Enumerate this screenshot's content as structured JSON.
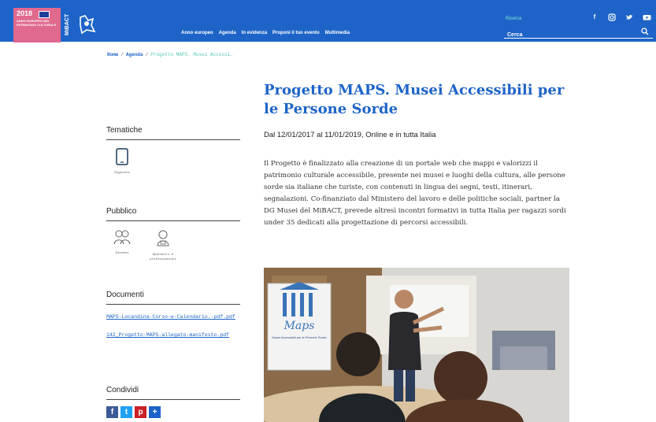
{
  "header": {
    "logo_year": "2018",
    "logo_text": "ANNO EUROPEO DEL PATRIMONIO CULTURALE",
    "ministry": "MiBACT",
    "nav": [
      "Anno europeo",
      "Agenda",
      "In evidenza",
      "Proponi il tuo evento",
      "Multimedia"
    ],
    "search_label": "Ricerca",
    "search_placeholder": "Cerca",
    "social": [
      "f",
      "ig",
      "tw",
      "yt"
    ],
    "brand_color": "#1e64c8",
    "logo_color": "#e0698e"
  },
  "breadcrumb": {
    "home": "Home",
    "agenda": "Agenda",
    "current": "Progetto MAPS. Musei Accessi…"
  },
  "article": {
    "title": "Progetto MAPS. Musei Accessibili per le Persone Sorde",
    "dates": "Dal 12/01/2017 al 11/01/2019, Online e in tutta Italia",
    "description": "Il Progetto è finalizzato alla creazione di un portale web che mappi e valorizzi il patrimonio culturale accessibile, presente nei musei e luoghi della cultura, alle persone sorde sia italiane che turiste, con contenuti in lingua dei segni, testi, itinerari, segnalazioni. Co-finanziato dal Ministero del lavoro e delle politiche sociali, partner la DG Musei del MiBACT, prevede altresì incontri formativi in tutta Italia per ragazzi sordi under 35 dedicati alla progettazione di percorsi accessibili."
  },
  "sidebar": {
    "tematiche": {
      "title": "Tematiche",
      "items": [
        {
          "label": "Digitale",
          "icon": "tablet-icon"
        }
      ]
    },
    "pubblico": {
      "title": "Pubblico",
      "items": [
        {
          "label": "Giovani",
          "icon": "young-people-icon"
        },
        {
          "label": "Operatori e professionisti",
          "icon": "operator-icon"
        }
      ]
    },
    "documenti": {
      "title": "Documenti",
      "items": [
        "MAPS-Locandina-Corso-e-Calendario.-pdf.pdf",
        "142_Progetto-MAPS-allegato-manifesto.pdf"
      ]
    },
    "condividi": {
      "title": "Condividi",
      "items": [
        {
          "label": "f",
          "icon": "facebook-icon",
          "color": "#3b5998"
        },
        {
          "label": "t",
          "icon": "twitter-icon",
          "color": "#1da1f2"
        },
        {
          "label": "p",
          "icon": "pinterest-icon",
          "color": "#cb2027"
        },
        {
          "label": "+",
          "icon": "share-plus-icon",
          "color": "#1e64c8"
        }
      ]
    }
  },
  "photo": {
    "poster_title": "Maps",
    "poster_subtitle": "Musei Accessibili per le Persone Sorde"
  }
}
